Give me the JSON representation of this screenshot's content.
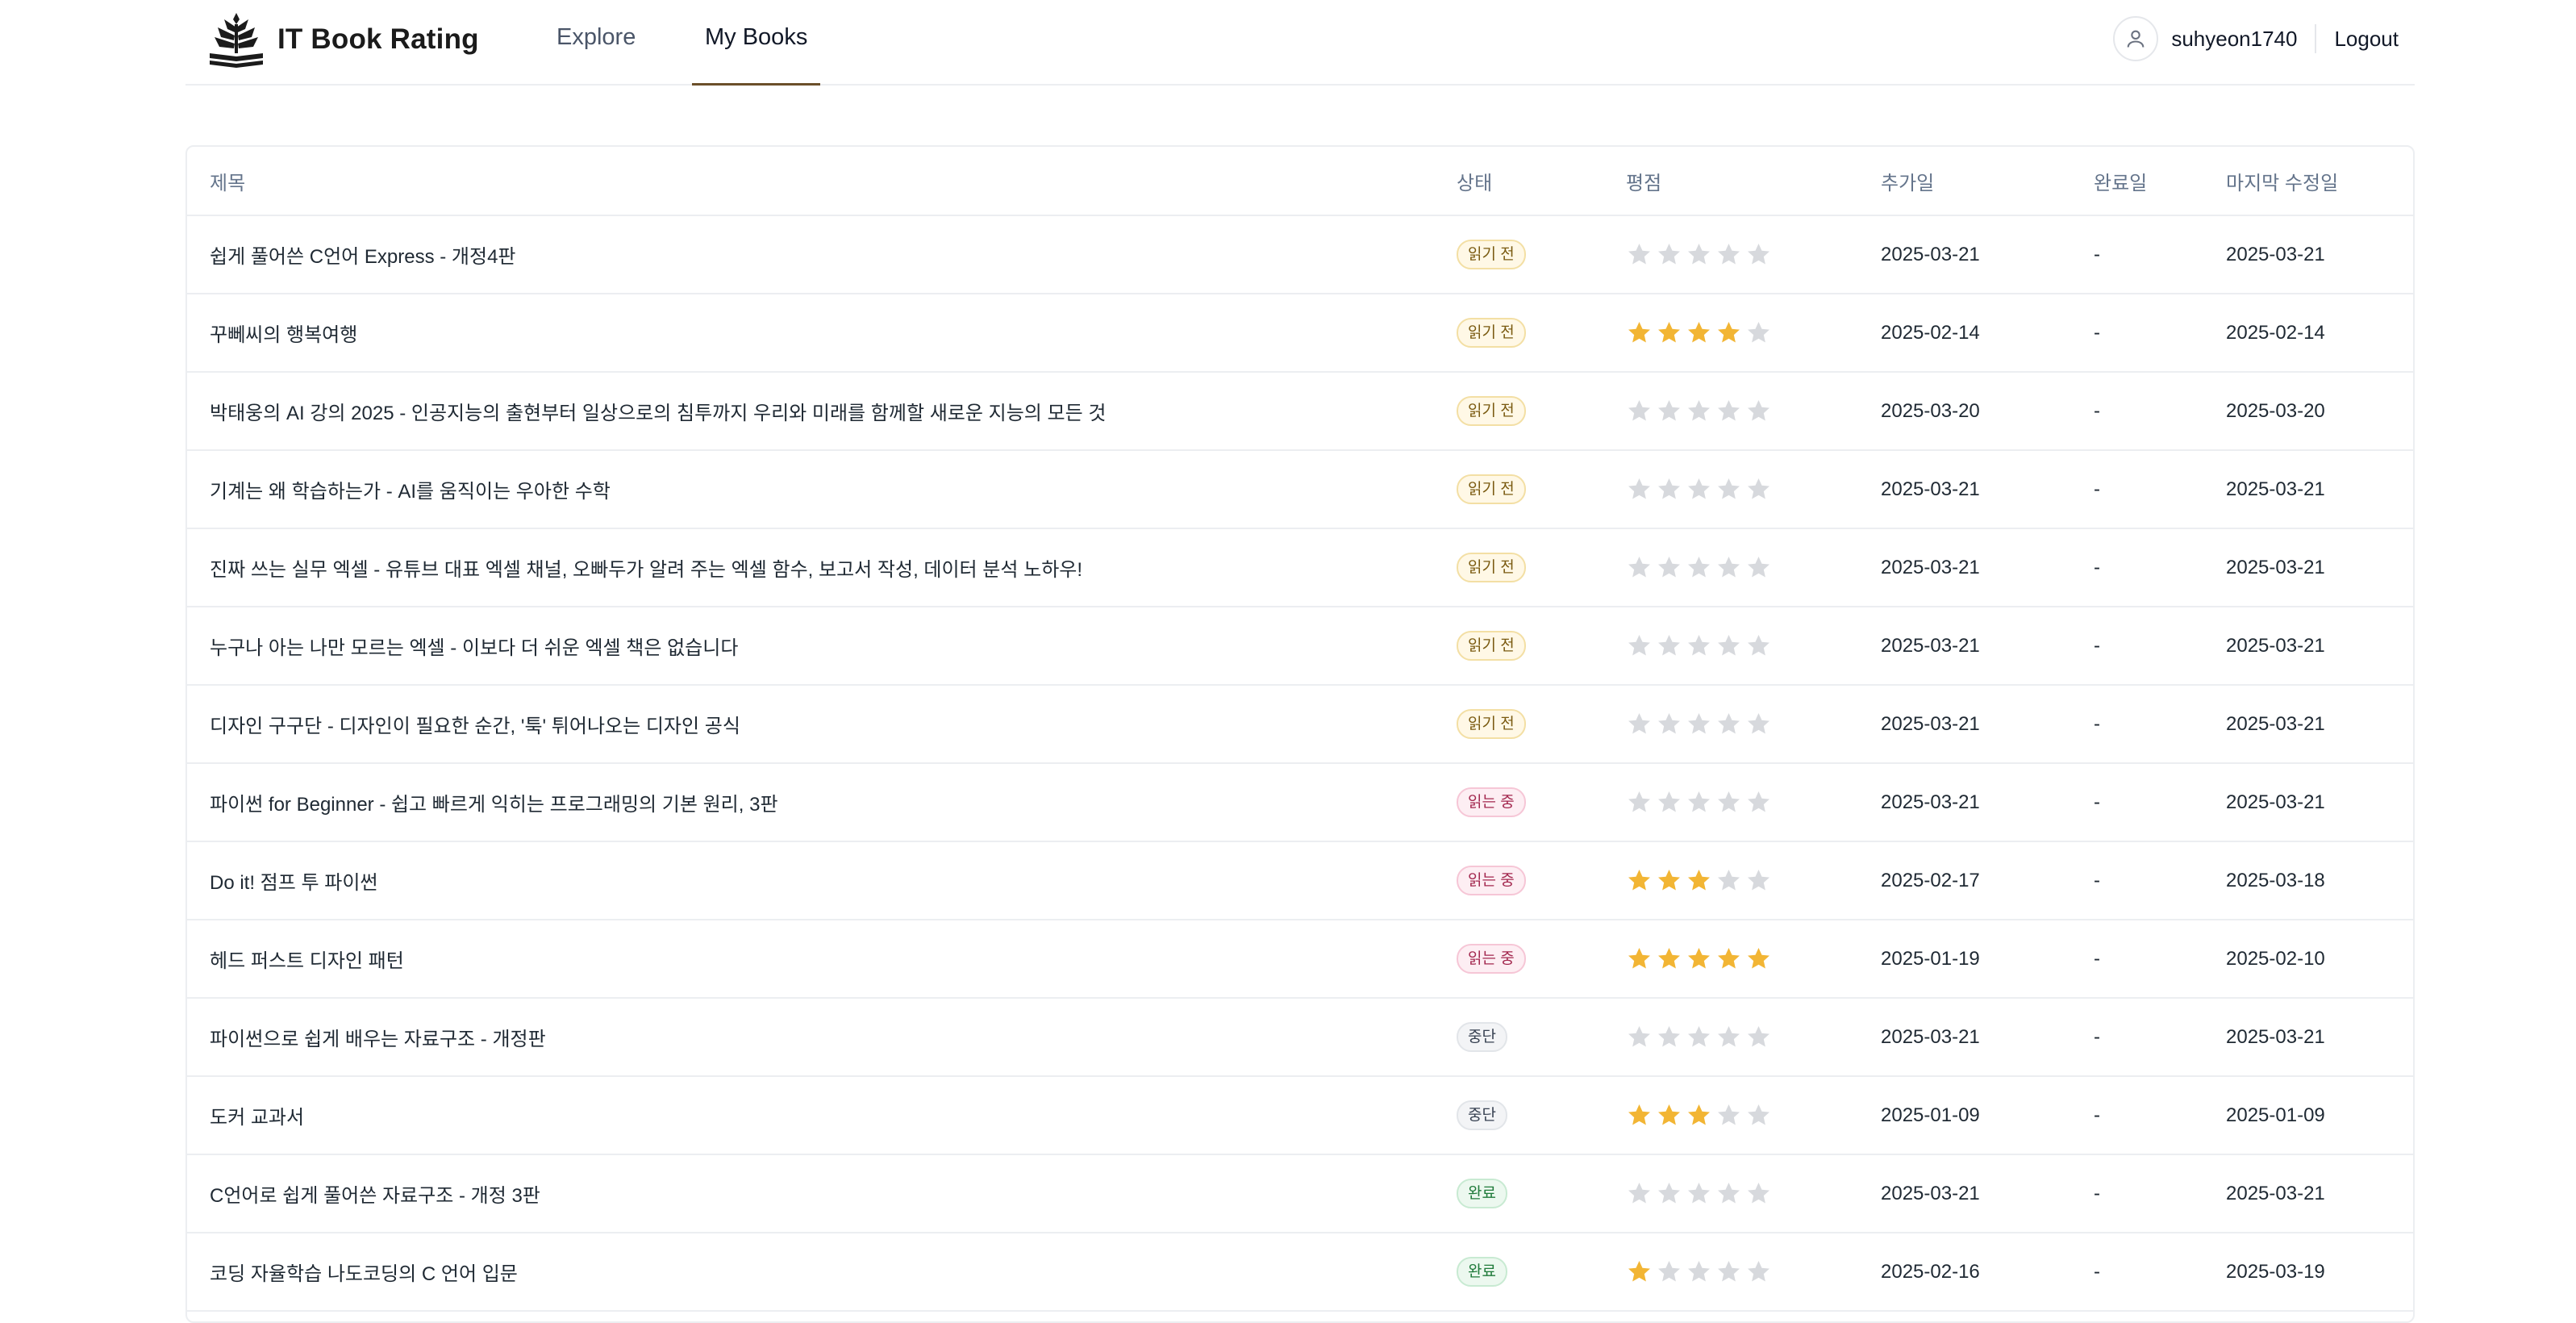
{
  "app": {
    "title": "IT Book Rating"
  },
  "nav": {
    "explore": "Explore",
    "my_books": "My Books"
  },
  "user": {
    "name": "suhyeon1740",
    "logout": "Logout"
  },
  "colors": {
    "star_on": "#f2b534",
    "star_off": "#d7d9dd",
    "accent": "#6b4f2a"
  },
  "table": {
    "headers": {
      "title": "제목",
      "status": "상태",
      "rating": "평점",
      "added": "추가일",
      "completed": "완료일",
      "modified": "마지막 수정일"
    },
    "rows": [
      {
        "title": "쉽게 풀어쓴 C언어 Express - 개정4판",
        "status": "읽기 전",
        "status_type": "unread",
        "rating": 0,
        "added": "2025-03-21",
        "completed": "-",
        "modified": "2025-03-21"
      },
      {
        "title": "꾸뻬씨의 행복여행",
        "status": "읽기 전",
        "status_type": "unread",
        "rating": 4,
        "added": "2025-02-14",
        "completed": "-",
        "modified": "2025-02-14"
      },
      {
        "title": "박태웅의 AI 강의 2025 - 인공지능의 출현부터 일상으로의 침투까지 우리와 미래를 함께할 새로운 지능의 모든 것",
        "status": "읽기 전",
        "status_type": "unread",
        "rating": 0,
        "added": "2025-03-20",
        "completed": "-",
        "modified": "2025-03-20"
      },
      {
        "title": "기계는 왜 학습하는가 - AI를 움직이는 우아한 수학",
        "status": "읽기 전",
        "status_type": "unread",
        "rating": 0,
        "added": "2025-03-21",
        "completed": "-",
        "modified": "2025-03-21"
      },
      {
        "title": "진짜 쓰는 실무 엑셀 - 유튜브 대표 엑셀 채널, 오빠두가 알려 주는 엑셀 함수, 보고서 작성, 데이터 분석 노하우!",
        "status": "읽기 전",
        "status_type": "unread",
        "rating": 0,
        "added": "2025-03-21",
        "completed": "-",
        "modified": "2025-03-21"
      },
      {
        "title": "누구나 아는 나만 모르는 엑셀 - 이보다 더 쉬운 엑셀 책은 없습니다",
        "status": "읽기 전",
        "status_type": "unread",
        "rating": 0,
        "added": "2025-03-21",
        "completed": "-",
        "modified": "2025-03-21"
      },
      {
        "title": "디자인 구구단 - 디자인이 필요한 순간, '툭' 튀어나오는 디자인 공식",
        "status": "읽기 전",
        "status_type": "unread",
        "rating": 0,
        "added": "2025-03-21",
        "completed": "-",
        "modified": "2025-03-21"
      },
      {
        "title": "파이썬 for Beginner - 쉽고 빠르게 익히는 프로그래밍의 기본 원리, 3판",
        "status": "읽는 중",
        "status_type": "reading",
        "rating": 0,
        "added": "2025-03-21",
        "completed": "-",
        "modified": "2025-03-21"
      },
      {
        "title": "Do it! 점프 투 파이썬",
        "status": "읽는 중",
        "status_type": "reading",
        "rating": 3,
        "added": "2025-02-17",
        "completed": "-",
        "modified": "2025-03-18"
      },
      {
        "title": "헤드 퍼스트 디자인 패턴",
        "status": "읽는 중",
        "status_type": "reading",
        "rating": 5,
        "added": "2025-01-19",
        "completed": "-",
        "modified": "2025-02-10"
      },
      {
        "title": "파이썬으로 쉽게 배우는 자료구조 - 개정판",
        "status": "중단",
        "status_type": "stopped",
        "rating": 0,
        "added": "2025-03-21",
        "completed": "-",
        "modified": "2025-03-21"
      },
      {
        "title": "도커 교과서",
        "status": "중단",
        "status_type": "stopped",
        "rating": 3,
        "added": "2025-01-09",
        "completed": "-",
        "modified": "2025-01-09"
      },
      {
        "title": "C언어로 쉽게 풀어쓴 자료구조 - 개정 3판",
        "status": "완료",
        "status_type": "done",
        "rating": 0,
        "added": "2025-03-21",
        "completed": "-",
        "modified": "2025-03-21"
      },
      {
        "title": "코딩 자율학습 나도코딩의 C 언어 입문",
        "status": "완료",
        "status_type": "done",
        "rating": 1,
        "added": "2025-02-16",
        "completed": "-",
        "modified": "2025-03-19"
      }
    ]
  }
}
